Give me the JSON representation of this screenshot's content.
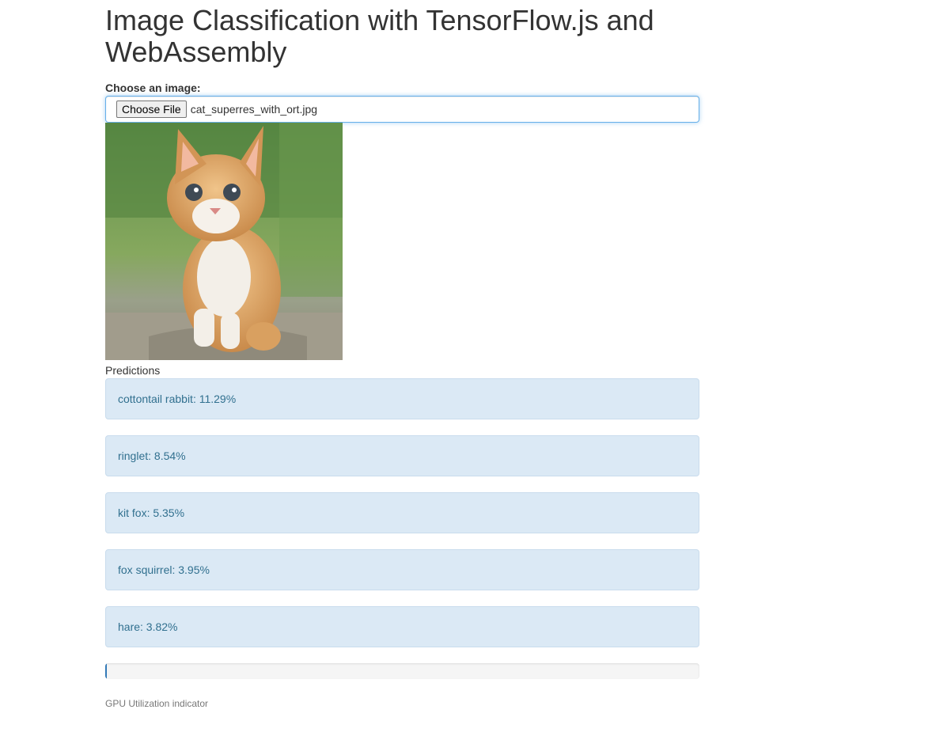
{
  "page": {
    "title": "Image Classification with TensorFlow.js and WebAssembly"
  },
  "upload": {
    "label": "Choose an image:",
    "button_label": "Choose File",
    "file_name": "cat_superres_with_ort.jpg"
  },
  "predictions": {
    "heading": "Predictions",
    "items": [
      {
        "text": "cottontail rabbit: 11.29%"
      },
      {
        "text": "ringlet: 8.54%"
      },
      {
        "text": "kit fox: 5.35%"
      },
      {
        "text": "fox squirrel: 3.95%"
      },
      {
        "text": "hare: 3.82%"
      }
    ]
  },
  "gpu": {
    "label": "GPU Utilization indicator",
    "utilization_fraction": 0.002
  },
  "colors": {
    "alert_bg": "#dbe9f5",
    "alert_text": "#31708f",
    "progress_fill": "#337ab7"
  }
}
